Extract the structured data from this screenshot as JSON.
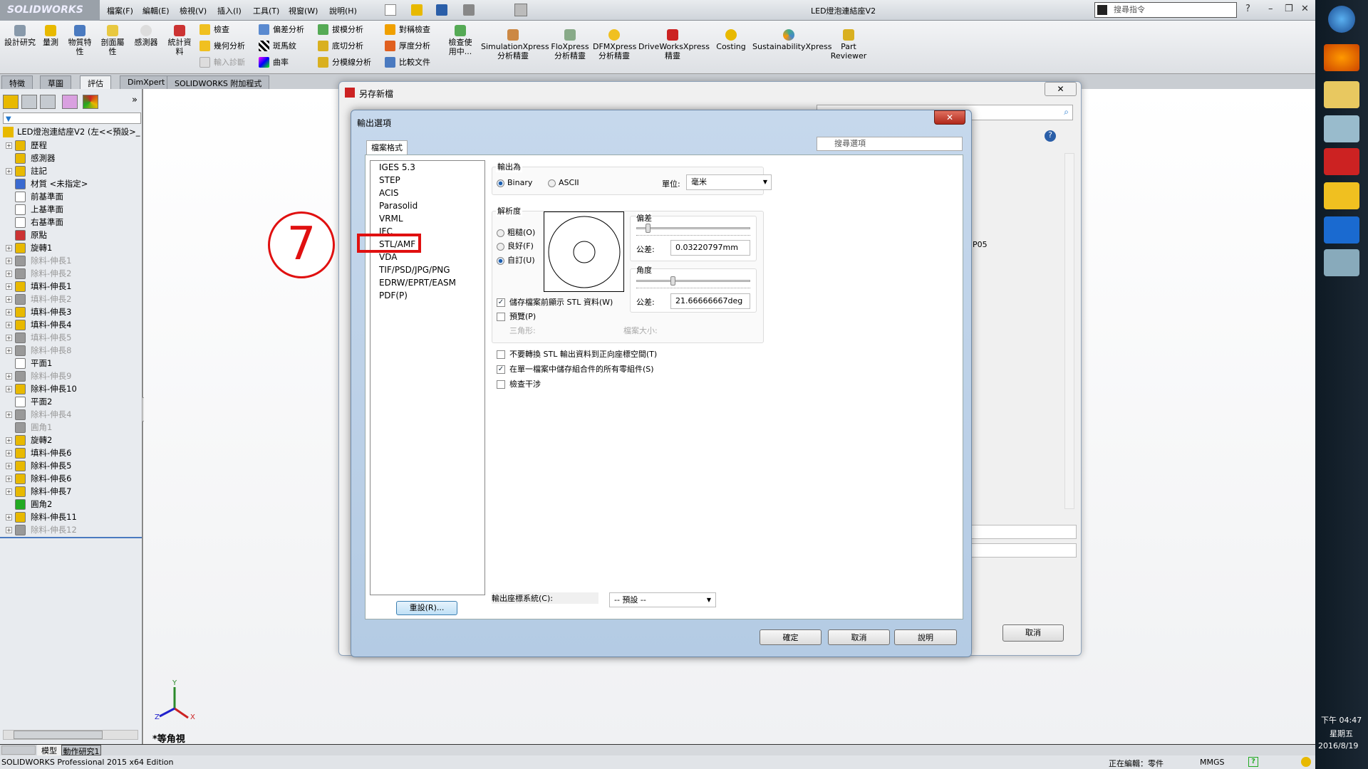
{
  "app": {
    "logo": "SOLIDWORKS",
    "title": "LED燈泡連結座V2",
    "search_placeholder": "搜尋指令",
    "menu": [
      "檔案(F)",
      "編輯(E)",
      "檢視(V)",
      "插入(I)",
      "工具(T)",
      "視窗(W)",
      "說明(H)"
    ]
  },
  "ribbon": {
    "large": [
      "設計研究",
      "量測",
      "物質特性",
      "剖面屬性",
      "感測器",
      "統計資料"
    ],
    "small": [
      "檢查",
      "幾何分析",
      "輸入診斷",
      "偏差分析",
      "斑馬紋",
      "曲率",
      "拔模分析",
      "底切分析",
      "分模線分析",
      "對稱檢查",
      "厚度分析",
      "比較文件",
      "檢查使用中..."
    ],
    "xpress": [
      "SimulationXpress 分析精靈",
      "FloXpress 分析精靈",
      "DFMXpress 分析精靈",
      "DriveWorksXpress 精靈",
      "Costing",
      "SustainabilityXpress",
      "Part Reviewer"
    ]
  },
  "tabs": [
    "特徵",
    "草圖",
    "評估",
    "DimXpert",
    "SOLIDWORKS 附加程式"
  ],
  "active_tab": "評估",
  "tree": {
    "root": "LED燈泡連結座V2 (左<<預設>_",
    "items": [
      {
        "label": "歷程",
        "exp": true,
        "color": "#e8b900"
      },
      {
        "label": "感測器",
        "exp": false,
        "color": "#e8b900"
      },
      {
        "label": "註記",
        "exp": true,
        "color": "#e8b900"
      },
      {
        "label": "材質 <未指定>",
        "exp": false,
        "color": "#3a6ad0"
      },
      {
        "label": "前基準面",
        "exp": false,
        "color": "#fff"
      },
      {
        "label": "上基準面",
        "exp": false,
        "color": "#fff"
      },
      {
        "label": "右基準面",
        "exp": false,
        "color": "#fff"
      },
      {
        "label": "原點",
        "exp": false,
        "color": "#c33"
      },
      {
        "label": "旋轉1",
        "exp": true,
        "color": "#e8b900"
      },
      {
        "label": "除料-伸長1",
        "exp": true,
        "dim": true,
        "color": "#999"
      },
      {
        "label": "除料-伸長2",
        "exp": true,
        "dim": true,
        "color": "#999"
      },
      {
        "label": "填料-伸長1",
        "exp": true,
        "color": "#e8b900"
      },
      {
        "label": "填料-伸長2",
        "exp": true,
        "dim": true,
        "color": "#999"
      },
      {
        "label": "填料-伸長3",
        "exp": true,
        "color": "#e8b900"
      },
      {
        "label": "填料-伸長4",
        "exp": true,
        "color": "#e8b900"
      },
      {
        "label": "填料-伸長5",
        "exp": true,
        "dim": true,
        "color": "#999"
      },
      {
        "label": "除料-伸長8",
        "exp": true,
        "dim": true,
        "color": "#999"
      },
      {
        "label": "平面1",
        "exp": false,
        "color": "#fff"
      },
      {
        "label": "除料-伸長9",
        "exp": true,
        "dim": true,
        "color": "#999"
      },
      {
        "label": "除料-伸長10",
        "exp": true,
        "color": "#e8b900"
      },
      {
        "label": "平面2",
        "exp": false,
        "color": "#fff"
      },
      {
        "label": "除料-伸長4",
        "exp": true,
        "dim": true,
        "color": "#999"
      },
      {
        "label": "圓角1",
        "exp": false,
        "dim": true,
        "color": "#999"
      },
      {
        "label": "旋轉2",
        "exp": true,
        "color": "#e8b900"
      },
      {
        "label": "填料-伸長6",
        "exp": true,
        "color": "#e8b900"
      },
      {
        "label": "除料-伸長5",
        "exp": true,
        "color": "#e8b900"
      },
      {
        "label": "除料-伸長6",
        "exp": true,
        "color": "#e8b900"
      },
      {
        "label": "除料-伸長7",
        "exp": true,
        "color": "#e8b900"
      },
      {
        "label": "圓角2",
        "exp": false,
        "color": "#2a2"
      },
      {
        "label": "除料-伸長11",
        "exp": true,
        "color": "#e8b900"
      },
      {
        "label": "除料-伸長12",
        "exp": true,
        "dim": true,
        "color": "#999"
      }
    ]
  },
  "viewport": {
    "view_name": "*等角視",
    "axes": [
      "Y",
      "Z",
      "X"
    ]
  },
  "bottom_tabs": [
    "模型",
    "動作研究1"
  ],
  "status": {
    "edition": "SOLIDWORKS Professional 2015 x64 Edition",
    "editing": "正在編輯：零件",
    "units": "MMGS"
  },
  "clock": {
    "time": "下午 04:47",
    "day": "星期五",
    "date": "2016/8/19"
  },
  "save_dialog": {
    "title": "另存新檔",
    "partial_text": "P05",
    "cancel": "取消"
  },
  "export_dialog": {
    "title": "輸出選項",
    "tab": "檔案格式",
    "search_placeholder": "搜尋選項",
    "formats": [
      "IGES 5.3",
      "STEP",
      "ACIS",
      "Parasolid",
      "VRML",
      "IFC",
      "STL/AMF",
      "VDA",
      "TIF/PSD/JPG/PNG",
      "EDRW/EPRT/EASM",
      "PDF(P)"
    ],
    "selected_format": "STL/AMF",
    "annotation": "7",
    "output_as": {
      "label": "輸出為",
      "options": [
        "Binary",
        "ASCII"
      ],
      "selected": "Binary"
    },
    "unit": {
      "label": "單位:",
      "value": "毫米"
    },
    "resolution": {
      "label": "解析度",
      "options": [
        "粗糙(O)",
        "良好(F)",
        "自訂(U)"
      ],
      "selected": "自訂(U)"
    },
    "deviation": {
      "label": "偏差",
      "tol_label": "公差:",
      "value": "0.03220797mm",
      "slider": 0.08
    },
    "angle": {
      "label": "角度",
      "tol_label": "公差:",
      "value": "21.66666667deg",
      "slider": 0.3
    },
    "show_info": {
      "label": "儲存檔案前顯示 STL 資料(W)",
      "checked": true
    },
    "preview": {
      "label": "預覽(P)",
      "checked": false
    },
    "triangles_label": "三角形:",
    "filesize_label": "檔案大小:",
    "opts": [
      {
        "label": "不要轉換 STL 輸出資料到正向座標空間(T)",
        "checked": false
      },
      {
        "label": "在單一檔案中儲存組合件的所有零組件(S)",
        "checked": true
      },
      {
        "label": "檢查干涉",
        "checked": false
      }
    ],
    "reset": "重設(R)...",
    "coord_label": "輸出座標系統(C):",
    "coord_value": "-- 預設 --",
    "ok": "確定",
    "cancel": "取消",
    "help": "說明"
  }
}
